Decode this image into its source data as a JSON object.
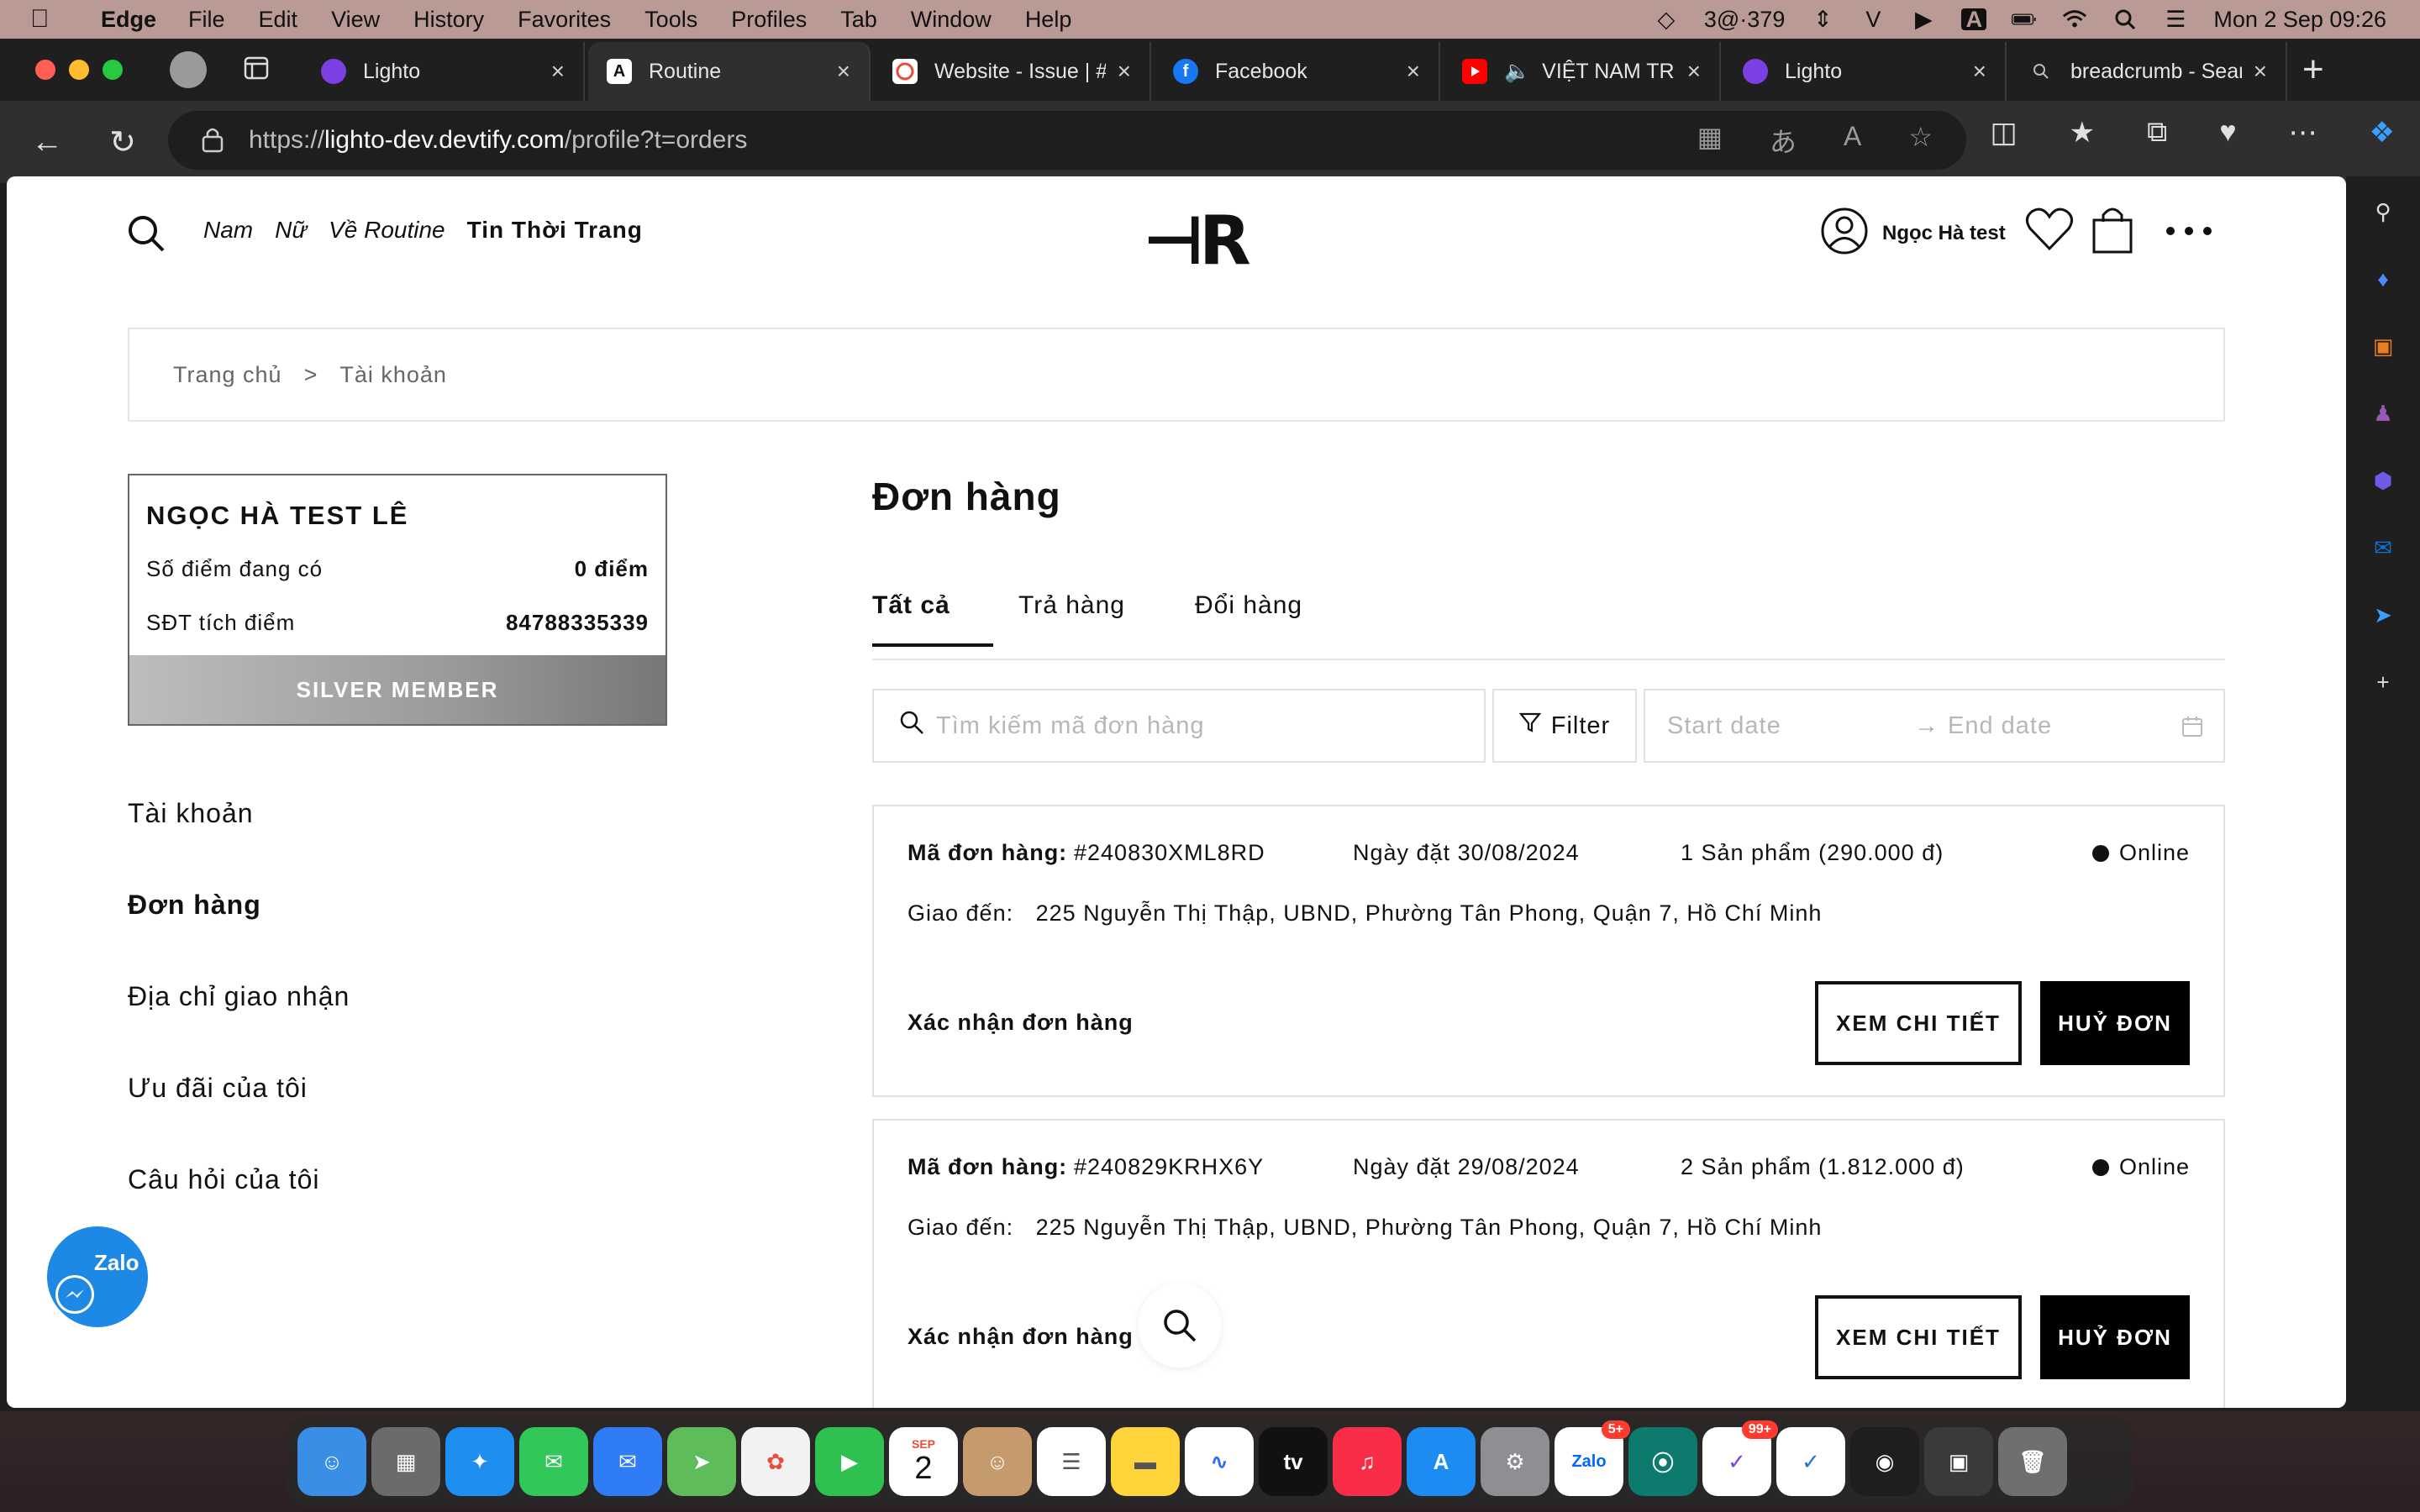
{
  "menubar": {
    "app": "Edge",
    "items": [
      "File",
      "Edit",
      "View",
      "History",
      "Favorites",
      "Tools",
      "Profiles",
      "Tab",
      "Window",
      "Help"
    ],
    "status_text": "3@·379",
    "clock": "Mon 2 Sep  09:26",
    "input_badge": "A"
  },
  "browser": {
    "tabs": [
      {
        "label": "Lighto",
        "fav_color": "#7b3fe4",
        "active": false
      },
      {
        "label": "Routine",
        "fav_color": "#111111",
        "fav_text": "A",
        "active": true
      },
      {
        "label": "Website - Issue | #",
        "fav_color": "#ffffff",
        "active": false
      },
      {
        "label": "Facebook",
        "fav_color": "#1877f2",
        "fav_text": "f",
        "active": false
      },
      {
        "label": "VIỆT NAM TRC",
        "fav_color": "#ff0000",
        "active": false
      },
      {
        "label": "Lighto",
        "fav_color": "#7b3fe4",
        "active": false
      },
      {
        "label": "breadcrumb - Sear",
        "fav_color": "#888888",
        "active": false
      }
    ],
    "url_scheme": "https://",
    "url_host": "lighto-dev.devtify.com",
    "url_path": "/profile?t=orders"
  },
  "site": {
    "nav": [
      "Nam",
      "Nữ",
      "Về Routine",
      "Tin Thời Trang"
    ],
    "logo": "⊣R",
    "user_name": "Ngọc Hà test"
  },
  "breadcrumb": {
    "home": "Trang chủ",
    "separator": ">",
    "current": "Tài khoản"
  },
  "member": {
    "name": "NGỌC HÀ TEST LÊ",
    "points_label": "Số điểm đang có",
    "points_value": "0 điểm",
    "phone_label": "SĐT tích điểm",
    "phone_value": "84788335339",
    "tier": "SILVER MEMBER"
  },
  "left_menu": [
    "Tài khoản",
    "Đơn hàng",
    "Địa chỉ giao nhận",
    "Ưu đãi của tôi",
    "Câu hỏi của tôi"
  ],
  "main": {
    "title": "Đơn hàng",
    "tabs": [
      "Tất cả",
      "Trả hàng",
      "Đổi hàng"
    ],
    "search_placeholder": "Tìm kiếm mã đơn hàng",
    "filter_label": "Filter",
    "start_date": "Start date",
    "end_date": "End date",
    "date_arrow": "→"
  },
  "orders": [
    {
      "code_label": "Mã đơn hàng:",
      "code": "#240830XML8RD",
      "date": "Ngày đặt 30/08/2024",
      "qty": "1 Sản phẩm (290.000 đ)",
      "status": "Online",
      "ship_label": "Giao đến:",
      "address": "225 Nguyễn Thị Thập, UBND, Phường Tân Phong, Quận 7, Hồ Chí Minh",
      "confirm": "Xác nhận đơn hàng",
      "detail_btn": "XEM CHI TIẾT",
      "cancel_btn": "HUỶ ĐƠN"
    },
    {
      "code_label": "Mã đơn hàng:",
      "code": "#240829KRHX6Y",
      "date": "Ngày đặt 29/08/2024",
      "qty": "2 Sản phẩm (1.812.000 đ)",
      "status": "Online",
      "ship_label": "Giao đến:",
      "address": "225 Nguyễn Thị Thập, UBND, Phường Tân Phong, Quận 7, Hồ Chí Minh",
      "confirm": "Xác nhận đơn hàng",
      "detail_btn": "XEM CHI TIẾT",
      "cancel_btn": "HUỶ ĐƠN"
    }
  ],
  "zalo": {
    "label": "Zalo"
  },
  "dock": {
    "calendar_month": "SEP",
    "calendar_day": "2",
    "tv_label": "tv",
    "zalo_label": "Zalo",
    "zalo_badge": "5+",
    "reminders_badge": "99+"
  }
}
